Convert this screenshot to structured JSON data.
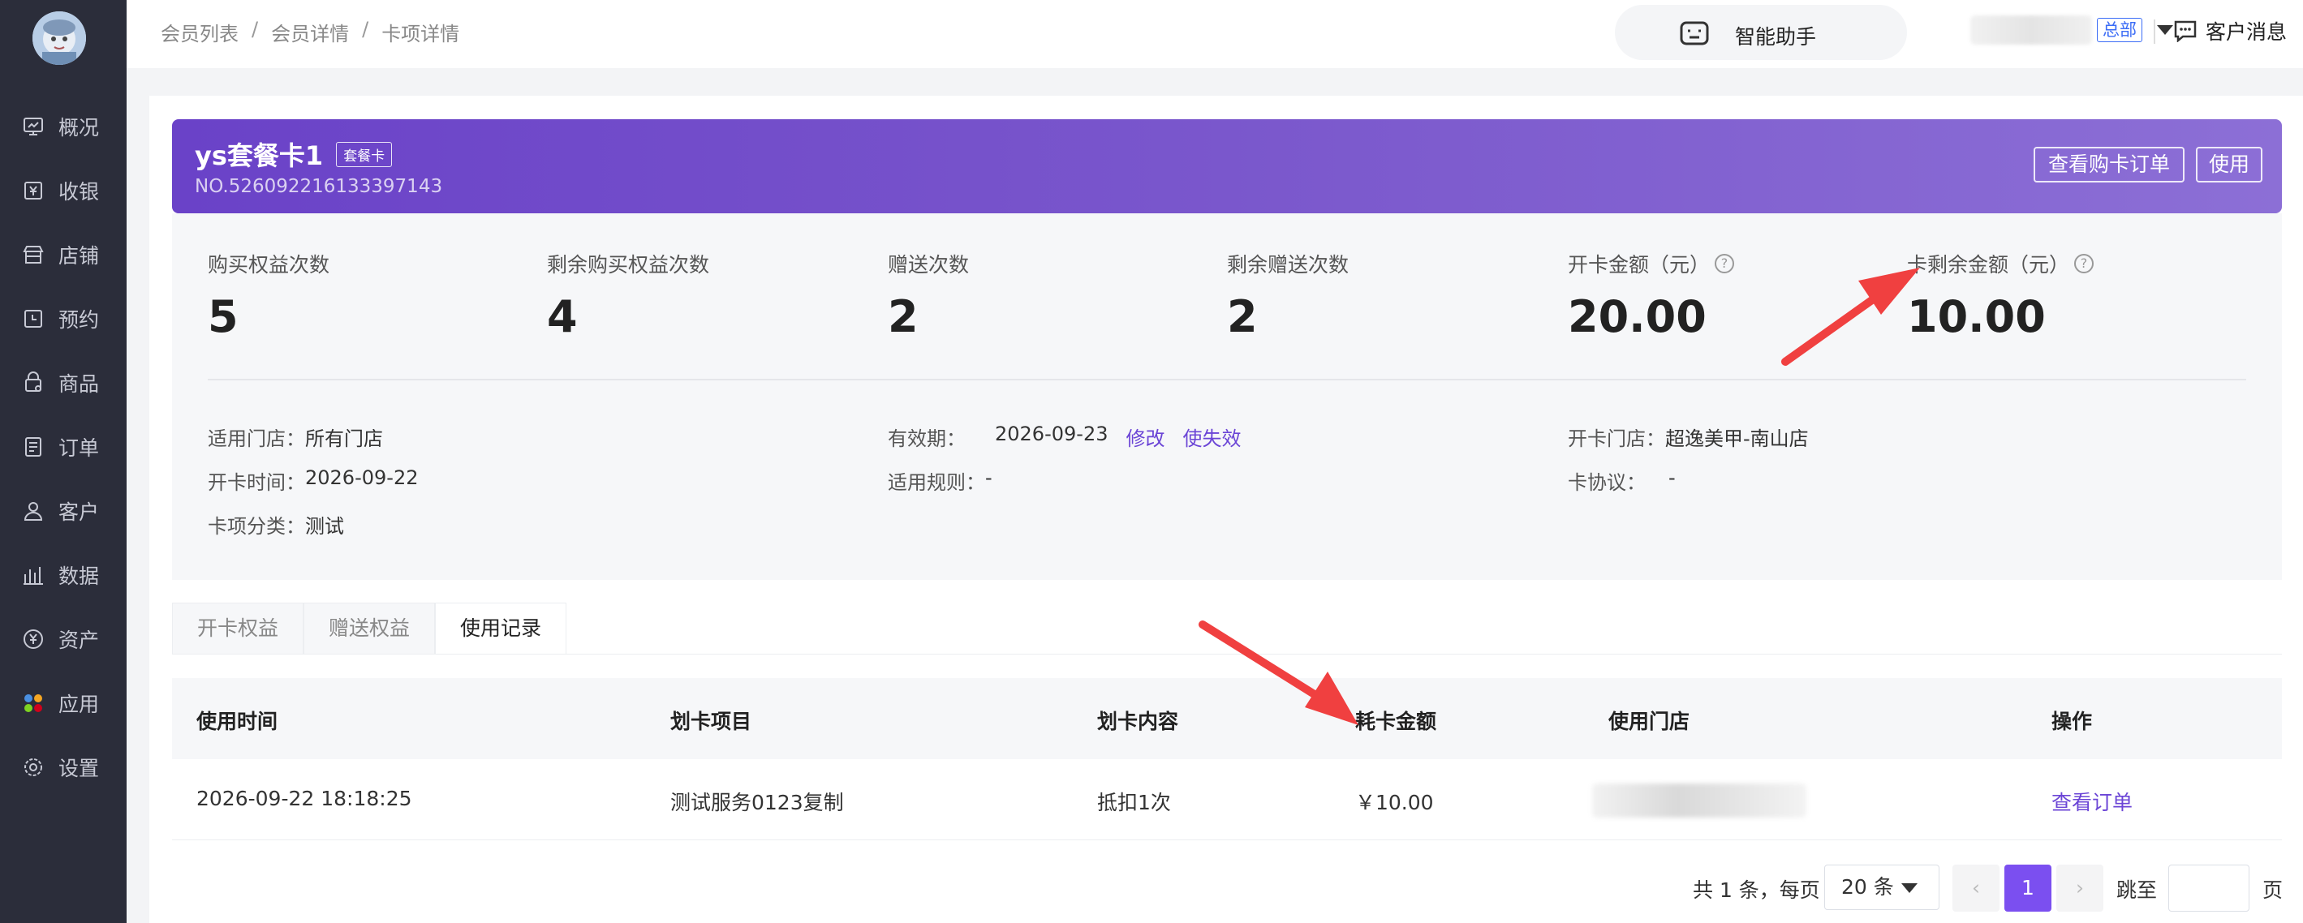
{
  "sidebar": {
    "items": [
      {
        "label": "概况",
        "icon": "overview-icon"
      },
      {
        "label": "收银",
        "icon": "cashier-icon"
      },
      {
        "label": "店铺",
        "icon": "store-icon"
      },
      {
        "label": "预约",
        "icon": "booking-icon"
      },
      {
        "label": "商品",
        "icon": "goods-icon"
      },
      {
        "label": "订单",
        "icon": "order-icon"
      },
      {
        "label": "客户",
        "icon": "customer-icon"
      },
      {
        "label": "数据",
        "icon": "data-icon"
      },
      {
        "label": "资产",
        "icon": "asset-icon"
      },
      {
        "label": "应用",
        "icon": "apps-icon"
      },
      {
        "label": "设置",
        "icon": "settings-icon"
      }
    ]
  },
  "header": {
    "breadcrumb": [
      "会员列表",
      "会员详情",
      "卡项详情"
    ],
    "breadcrumb_sep": "/",
    "assistant_label": "智能助手",
    "org_badge": "总部",
    "customer_messages": "客户消息"
  },
  "card": {
    "title": "ys套餐卡1",
    "tag": "套餐卡",
    "number": "NO.526092216133397143",
    "buttons": {
      "view_orders": "查看购卡订单",
      "use": "使用"
    },
    "stats": [
      {
        "label": "购买权益次数",
        "value": "5",
        "help": false
      },
      {
        "label": "剩余购买权益次数",
        "value": "4",
        "help": false
      },
      {
        "label": "赠送次数",
        "value": "2",
        "help": false
      },
      {
        "label": "剩余赠送次数",
        "value": "2",
        "help": false
      },
      {
        "label": "开卡金额（元）",
        "value": "20.00",
        "help": true
      },
      {
        "label": "卡剩余金额（元）",
        "value": "10.00",
        "help": true
      }
    ],
    "info": {
      "store_label": "适用门店：",
      "store_value": "所有门店",
      "open_time_label": "开卡时间：",
      "open_time_value": "2026-09-22",
      "category_label": "卡项分类：",
      "category_value": "测试",
      "validity_label": "有效期：",
      "validity_value": "2026-09-23",
      "modify_link": "修改",
      "invalidate_link": "使失效",
      "rules_label": "适用规则：",
      "rules_value": "-",
      "open_store_label": "开卡门店：",
      "open_store_value": "超逸美甲-南山店",
      "agreement_label": "卡协议：",
      "agreement_value": "-"
    },
    "help_glyph": "?"
  },
  "tabs": [
    {
      "label": "开卡权益",
      "active": false
    },
    {
      "label": "赠送权益",
      "active": false
    },
    {
      "label": "使用记录",
      "active": true
    }
  ],
  "table": {
    "columns": [
      "使用时间",
      "划卡项目",
      "划卡内容",
      "耗卡金额",
      "使用门店",
      "操作"
    ],
    "rows": [
      {
        "time": "2026-09-22 18:18:25",
        "item": "测试服务0123复制",
        "content": "抵扣1次",
        "amount": "￥10.00",
        "action": "查看订单"
      }
    ]
  },
  "pagination": {
    "total_text": "共 1 条，每页",
    "page_size": "20 条",
    "current_page": "1",
    "prev_glyph": "‹",
    "next_glyph": "›",
    "jump_label": "跳至",
    "page_suffix": "页"
  },
  "colors": {
    "sidebar_bg": "#2b2d3a",
    "header_gradient_start": "#6a42c8",
    "header_gradient_end": "#8c6fd6",
    "accent": "#7b4ff0",
    "link": "#6b45d6",
    "badge_blue": "#3b6cf6",
    "annotation_red": "#f04040"
  }
}
